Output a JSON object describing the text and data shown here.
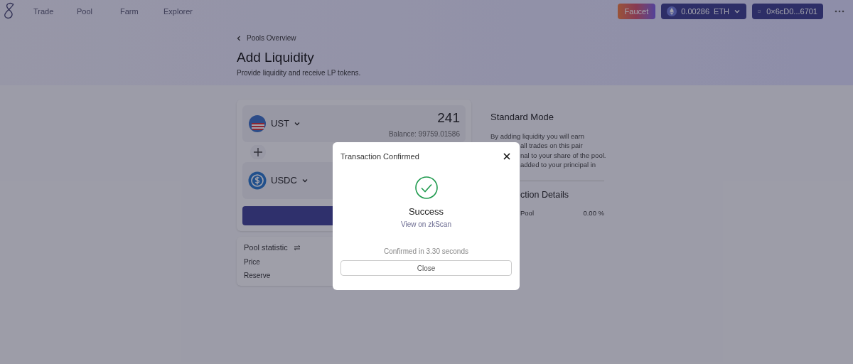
{
  "nav": {
    "items": [
      {
        "label": "Trade",
        "selected": false
      },
      {
        "label": "Pool",
        "selected": false
      },
      {
        "label": "Farm",
        "selected": false
      },
      {
        "label": "Explorer",
        "selected": false
      }
    ],
    "faucet": "Faucet",
    "balance": {
      "amount": "0.00286",
      "symbol": "ETH"
    },
    "wallet": "0×6cD0...6701"
  },
  "header": {
    "back": "Pools Overview",
    "title": "Add Liquidity",
    "subtitle": "Provide liquidity and receive LP tokens."
  },
  "tokens": [
    {
      "symbol": "UST",
      "amount": "241",
      "balance": "Balance: 99759.01586",
      "kind": "flag"
    },
    {
      "symbol": "USDC",
      "kind": "coin"
    }
  ],
  "pool_statistic": {
    "title": "Pool statistic",
    "rows": [
      "Price",
      "Reserve"
    ]
  },
  "info": {
    "title": "Standard Mode",
    "text_lines": [
      "By adding liquidity you will earn",
      "all trades on this pair",
      "nal to your share of the pool.",
      "added to your principal in"
    ],
    "details_title": "ction Details",
    "details": [
      {
        "label": "Pool",
        "value": "0.00 %"
      }
    ]
  },
  "modal": {
    "title": "Transaction Confirmed",
    "status": "Success",
    "link": "View on zkScan",
    "confirmed": "Confirmed in 3.30 seconds",
    "button": "Close"
  }
}
